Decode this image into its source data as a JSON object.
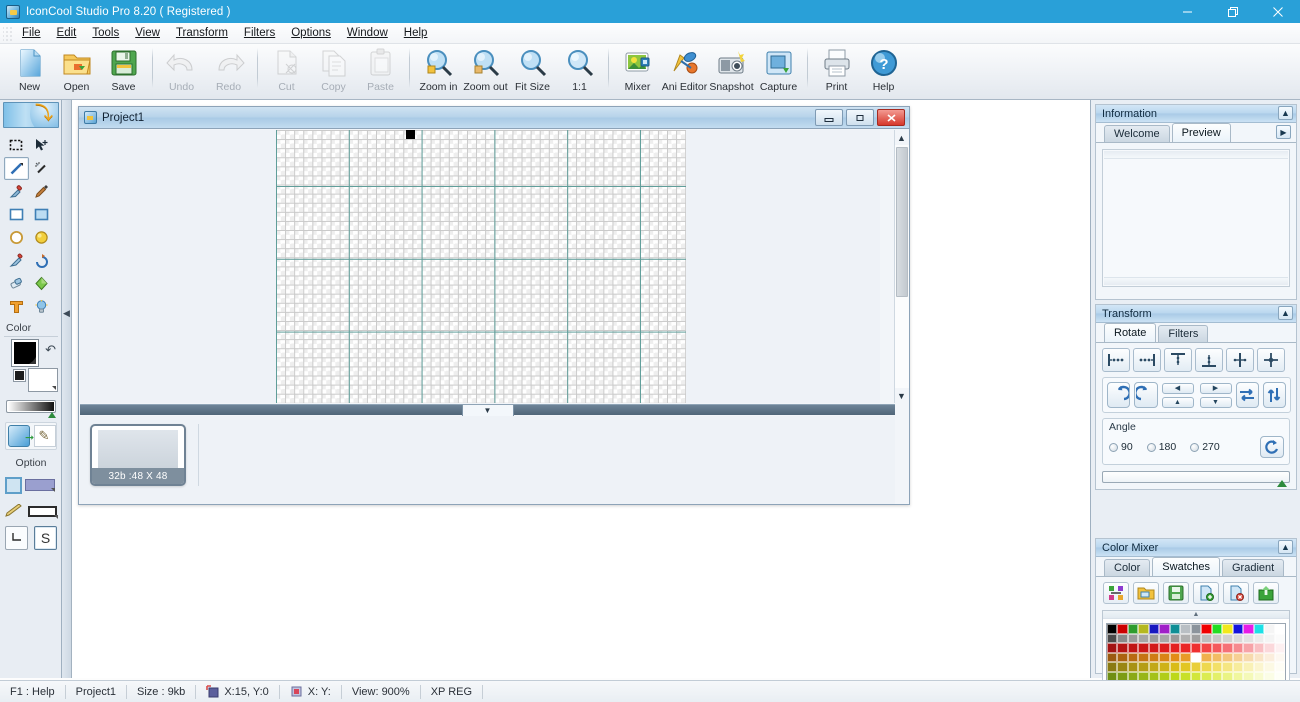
{
  "window": {
    "title": "IconCool Studio Pro 8.20 ( Registered )",
    "app_icon": "app-icon",
    "controls": {
      "minimize": "minimize",
      "restore": "restore",
      "close": "close"
    }
  },
  "menubar": {
    "items": [
      {
        "label": "File"
      },
      {
        "label": "Edit"
      },
      {
        "label": "Tools"
      },
      {
        "label": "View"
      },
      {
        "label": "Transform"
      },
      {
        "label": "Filters"
      },
      {
        "label": "Options"
      },
      {
        "label": "Window"
      },
      {
        "label": "Help"
      }
    ]
  },
  "toolbar": {
    "buttons": [
      {
        "label": "New",
        "icon": "new-document-icon",
        "disabled": false
      },
      {
        "label": "Open",
        "icon": "open-folder-icon",
        "disabled": false
      },
      {
        "label": "Save",
        "icon": "save-disk-icon",
        "disabled": false
      },
      {
        "label": "Undo",
        "icon": "undo-arrow-icon",
        "disabled": true
      },
      {
        "label": "Redo",
        "icon": "redo-arrow-icon",
        "disabled": true
      },
      {
        "label": "Cut",
        "icon": "cut-scissors-icon",
        "disabled": true
      },
      {
        "label": "Copy",
        "icon": "copy-pages-icon",
        "disabled": true
      },
      {
        "label": "Paste",
        "icon": "paste-clipboard-icon",
        "disabled": true
      },
      {
        "label": "Zoom in",
        "icon": "zoom-in-icon",
        "disabled": false
      },
      {
        "label": "Zoom out",
        "icon": "zoom-out-icon",
        "disabled": false
      },
      {
        "label": "Fit Size",
        "icon": "fit-size-icon",
        "disabled": false
      },
      {
        "label": "1:1",
        "icon": "actual-size-icon",
        "disabled": false
      },
      {
        "label": "Mixer",
        "icon": "mixer-icon",
        "disabled": false
      },
      {
        "label": "Ani Editor",
        "icon": "ani-editor-icon",
        "disabled": false
      },
      {
        "label": "Snapshot",
        "icon": "snapshot-camera-icon",
        "disabled": false
      },
      {
        "label": "Capture",
        "icon": "capture-screen-icon",
        "disabled": false
      },
      {
        "label": "Print",
        "icon": "printer-icon",
        "disabled": false
      },
      {
        "label": "Help",
        "icon": "help-question-icon",
        "disabled": false
      }
    ]
  },
  "tools": {
    "banner_icon": "banner-arrow-icon",
    "items": [
      {
        "name": "rectangle-select-tool",
        "selected": false
      },
      {
        "name": "move-tool",
        "selected": false
      },
      {
        "name": "line-tool",
        "selected": true
      },
      {
        "name": "magic-wand-tool",
        "selected": false
      },
      {
        "name": "eyedropper-tool",
        "selected": false
      },
      {
        "name": "paintbrush-tool",
        "selected": false
      },
      {
        "name": "rectangle-tool",
        "selected": false
      },
      {
        "name": "filled-rectangle-tool",
        "selected": false
      },
      {
        "name": "ellipse-tool",
        "selected": false
      },
      {
        "name": "filled-ellipse-tool",
        "selected": false
      },
      {
        "name": "airbrush-tool",
        "selected": false
      },
      {
        "name": "smudge-tool",
        "selected": false
      },
      {
        "name": "eraser-tool",
        "selected": false
      },
      {
        "name": "gradient-tool",
        "selected": false
      },
      {
        "name": "text-tool",
        "selected": false
      },
      {
        "name": "bulb-effect-tool",
        "selected": false
      }
    ],
    "color_label": "Color",
    "foreground_color": "#000000",
    "background_color": "#ffffff",
    "option_label": "Option",
    "option_buttons": [
      {
        "name": "shape-fill-option"
      },
      {
        "name": "brush-width-option"
      },
      {
        "name": "pencil-style-option"
      },
      {
        "name": "line-style-option"
      },
      {
        "name": "corner-option"
      },
      {
        "name": "smooth-option",
        "label": "S"
      }
    ]
  },
  "document": {
    "title": "Project1",
    "icon": "document-icon",
    "controls": {
      "minimize": "–",
      "restore": "▫",
      "close": "✕"
    },
    "thumbnail": {
      "caption": "32b :48 X 48"
    },
    "canvas": {
      "pixel_color": "#000000"
    }
  },
  "panels": {
    "information": {
      "title": "Information",
      "collapse_icon": "chevron-up-icon",
      "tabs": [
        {
          "label": "Welcome",
          "active": false
        },
        {
          "label": "Preview",
          "active": true
        }
      ],
      "more_icon": "chevron-right-icon"
    },
    "transform": {
      "title": "Transform",
      "collapse_icon": "chevron-up-icon",
      "tabs": [
        {
          "label": "Rotate",
          "active": true
        },
        {
          "label": "Filters",
          "active": false
        }
      ],
      "align_buttons": [
        {
          "name": "align-left-icon"
        },
        {
          "name": "align-right-icon"
        },
        {
          "name": "align-top-icon"
        },
        {
          "name": "align-bottom-icon"
        },
        {
          "name": "center-horizontal-icon"
        },
        {
          "name": "center-both-icon"
        }
      ],
      "rotate_buttons": [
        {
          "name": "rotate-counterclockwise-icon"
        },
        {
          "name": "rotate-clockwise-icon"
        }
      ],
      "nudge_buttons": [
        {
          "name": "nudge-left-icon",
          "glyph": "◀"
        },
        {
          "name": "nudge-right-icon",
          "glyph": "▶"
        },
        {
          "name": "nudge-up-icon",
          "glyph": "▲"
        },
        {
          "name": "nudge-down-icon",
          "glyph": "▼"
        }
      ],
      "flip_buttons": [
        {
          "name": "flip-horizontal-icon"
        },
        {
          "name": "flip-vertical-icon"
        }
      ],
      "angle": {
        "label": "Angle",
        "options": [
          {
            "label": "90",
            "selected": false
          },
          {
            "label": "180",
            "selected": false
          },
          {
            "label": "270",
            "selected": false
          }
        ],
        "custom_icon": "custom-rotate-icon"
      }
    },
    "color_mixer": {
      "title": "Color Mixer",
      "collapse_icon": "chevron-up-icon",
      "tabs": [
        {
          "label": "Color",
          "active": false
        },
        {
          "label": "Swatches",
          "active": true
        },
        {
          "label": "Gradient",
          "active": false
        }
      ],
      "tool_buttons": [
        {
          "name": "randomize-swatches-icon"
        },
        {
          "name": "load-swatches-icon"
        },
        {
          "name": "save-swatches-icon"
        },
        {
          "name": "add-swatch-icon"
        },
        {
          "name": "delete-swatch-icon"
        },
        {
          "name": "export-swatches-icon"
        }
      ],
      "swatch_rows": [
        [
          "#000000",
          "#cc0000",
          "#2e9c2e",
          "#b5b820",
          "#1818c0",
          "#a020c8",
          "#0f8f96",
          "#b9bfc4",
          "#8c949c",
          "#f00000",
          "#22dd22",
          "#f2e81c",
          "#1414dd",
          "#e61ce6",
          "#1ce0e6",
          "#f5f5f5",
          "#ffffff"
        ],
        [
          "#4a4a4a",
          "#8a8a8a",
          "#9a9a9a",
          "#a6a6a6",
          "#9c9c9c",
          "#a8a8a8",
          "#9a9a9a",
          "#b0b0b0",
          "#a0a0a0",
          "#bdbdbd",
          "#c8c8c8",
          "#d2d2d2",
          "#dadada",
          "#e2e2e2",
          "#ececec",
          "#f4f4f4",
          "#fbfbfb"
        ],
        [
          "#a31212",
          "#b51414",
          "#c01515",
          "#cb1717",
          "#d21919",
          "#dd1c1c",
          "#e42020",
          "#ea2626",
          "#ef3030",
          "#f24444",
          "#f4595c",
          "#f57177",
          "#f6898f",
          "#f7a3a8",
          "#f9bec2",
          "#fbd8db",
          "#fdf0f1"
        ],
        [
          "#9c5a10",
          "#ab6311",
          "#b86b12",
          "#c57413",
          "#cf7c14",
          "#d98415",
          "#e28c17",
          "#e89b28",
          "#ec a63a",
          "#f0b14d",
          "#f2bc64",
          "#f4c67c",
          "#f6d094",
          "#f7daad",
          "#f9e4c6",
          "#fbeedd",
          "#fdf8f1"
        ],
        [
          "#8a7a12",
          "#998613",
          "#a89214",
          "#b59d15",
          "#c2a816",
          "#ceb217",
          "#d9bc18",
          "#e2c624",
          "#e9cf38",
          "#eed84f",
          "#f2e068",
          "#f5e682",
          "#f7ec9c",
          "#f9f1b6",
          "#fbf5cf",
          "#fcf9e4",
          "#fefdf5"
        ],
        [
          "#6f8f14",
          "#7c9c15",
          "#8aa916",
          "#97b617",
          "#a4c218",
          "#b1cd19",
          "#bdd81a",
          "#c8e028",
          "#d2e63c",
          "#dbec52",
          "#e3f06a",
          "#eaf484",
          "#f0f79e",
          "#f4f9b8",
          "#f8fbd0",
          "#fbfde6",
          "#fefff7"
        ]
      ]
    }
  },
  "statusbar": {
    "cells": [
      {
        "label": "F1 : Help",
        "icon": null
      },
      {
        "label": "Project1",
        "icon": null
      },
      {
        "label": "Size : 9kb",
        "icon": null
      },
      {
        "label": "X:15, Y:0",
        "icon": "canvas-coord-icon"
      },
      {
        "label": "X: Y:",
        "icon": "cursor-coord-icon"
      },
      {
        "label": "View: 900%",
        "icon": null
      },
      {
        "label": "XP REG",
        "icon": null
      }
    ]
  }
}
